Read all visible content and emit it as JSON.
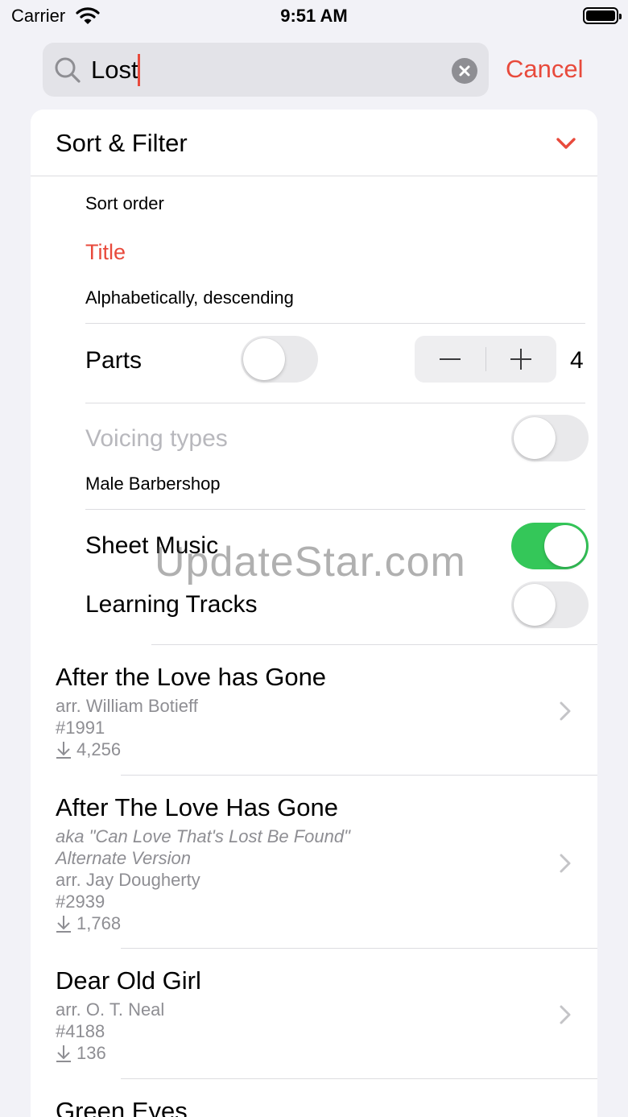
{
  "status_bar": {
    "carrier": "Carrier",
    "time": "9:51 AM"
  },
  "search": {
    "query": "Lost",
    "cancel_label": "Cancel"
  },
  "sort_filter": {
    "title": "Sort & Filter",
    "sort_order_label": "Sort order",
    "sort_value": "Title",
    "sort_direction": "Alphabetically, descending",
    "parts_label": "Parts",
    "parts_toggle_on": false,
    "parts_count": "4",
    "voicing_label": "Voicing types",
    "voicing_toggle_on": false,
    "voicing_value": "Male Barbershop",
    "sheet_music_label": "Sheet Music",
    "sheet_music_on": true,
    "learning_tracks_label": "Learning Tracks",
    "learning_tracks_on": false
  },
  "songs": [
    {
      "title": "After the Love has Gone",
      "arranger": "arr. William Botieff",
      "number": "#1991",
      "downloads": "4,256"
    },
    {
      "title": "After The Love Has Gone",
      "aka": "aka \"Can Love That's Lost Be Found\"",
      "version": "Alternate Version",
      "arranger": "arr. Jay Dougherty",
      "number": "#2939",
      "downloads": "1,768"
    },
    {
      "title": "Dear Old Girl",
      "arranger": "arr. O. T. Neal",
      "number": "#4188",
      "downloads": "136"
    },
    {
      "title": "Green Eyes"
    }
  ],
  "watermark": "UpdateStar.com",
  "colors": {
    "accent": "#e84a3c",
    "toggle_on": "#34c759",
    "secondary_text": "#8e8e93",
    "background": "#f2f2f7"
  }
}
